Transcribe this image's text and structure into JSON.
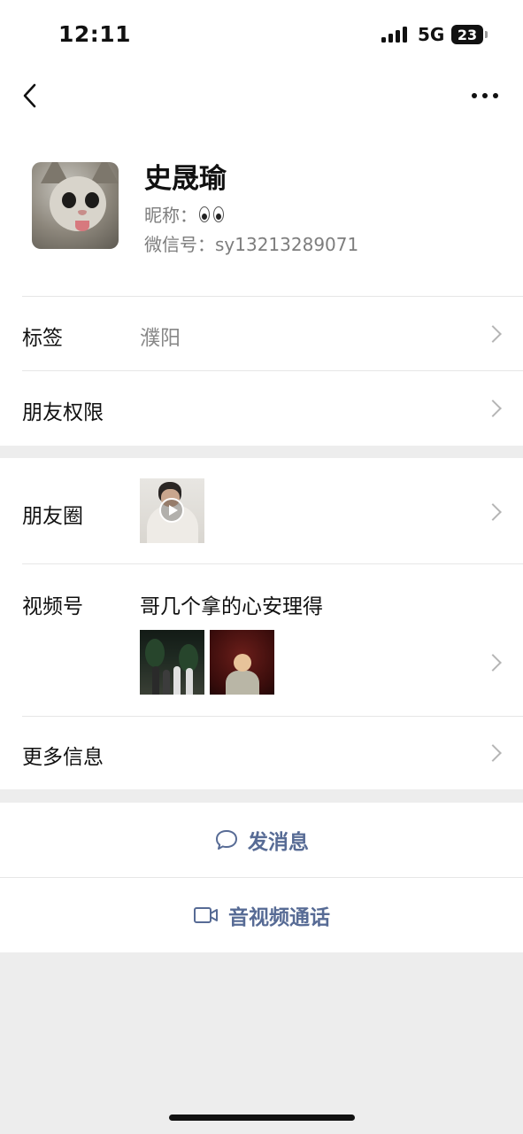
{
  "status_bar": {
    "time": "12:11",
    "network": "5G",
    "battery": "23"
  },
  "nav": {
    "back_icon": "chevron-left-icon",
    "more_icon": "ellipsis-icon"
  },
  "profile": {
    "name": "史晟瑜",
    "nickname_label": "昵称：",
    "nickname_value": "👀",
    "wechat_id_label": "微信号：",
    "wechat_id": "sy13213289071"
  },
  "rows": {
    "tags_label": "标签",
    "tags_value": "濮阳",
    "friend_permissions_label": "朋友权限",
    "moments_label": "朋友圈",
    "channels_label": "视频号",
    "channels_title": "哥几个拿的心安理得",
    "more_info_label": "更多信息"
  },
  "actions": {
    "message_label": "发消息",
    "call_label": "音视频通话"
  },
  "colors": {
    "link_blue": "#576b95",
    "background_gray": "#ededed",
    "divider": "#e6e6e6"
  }
}
